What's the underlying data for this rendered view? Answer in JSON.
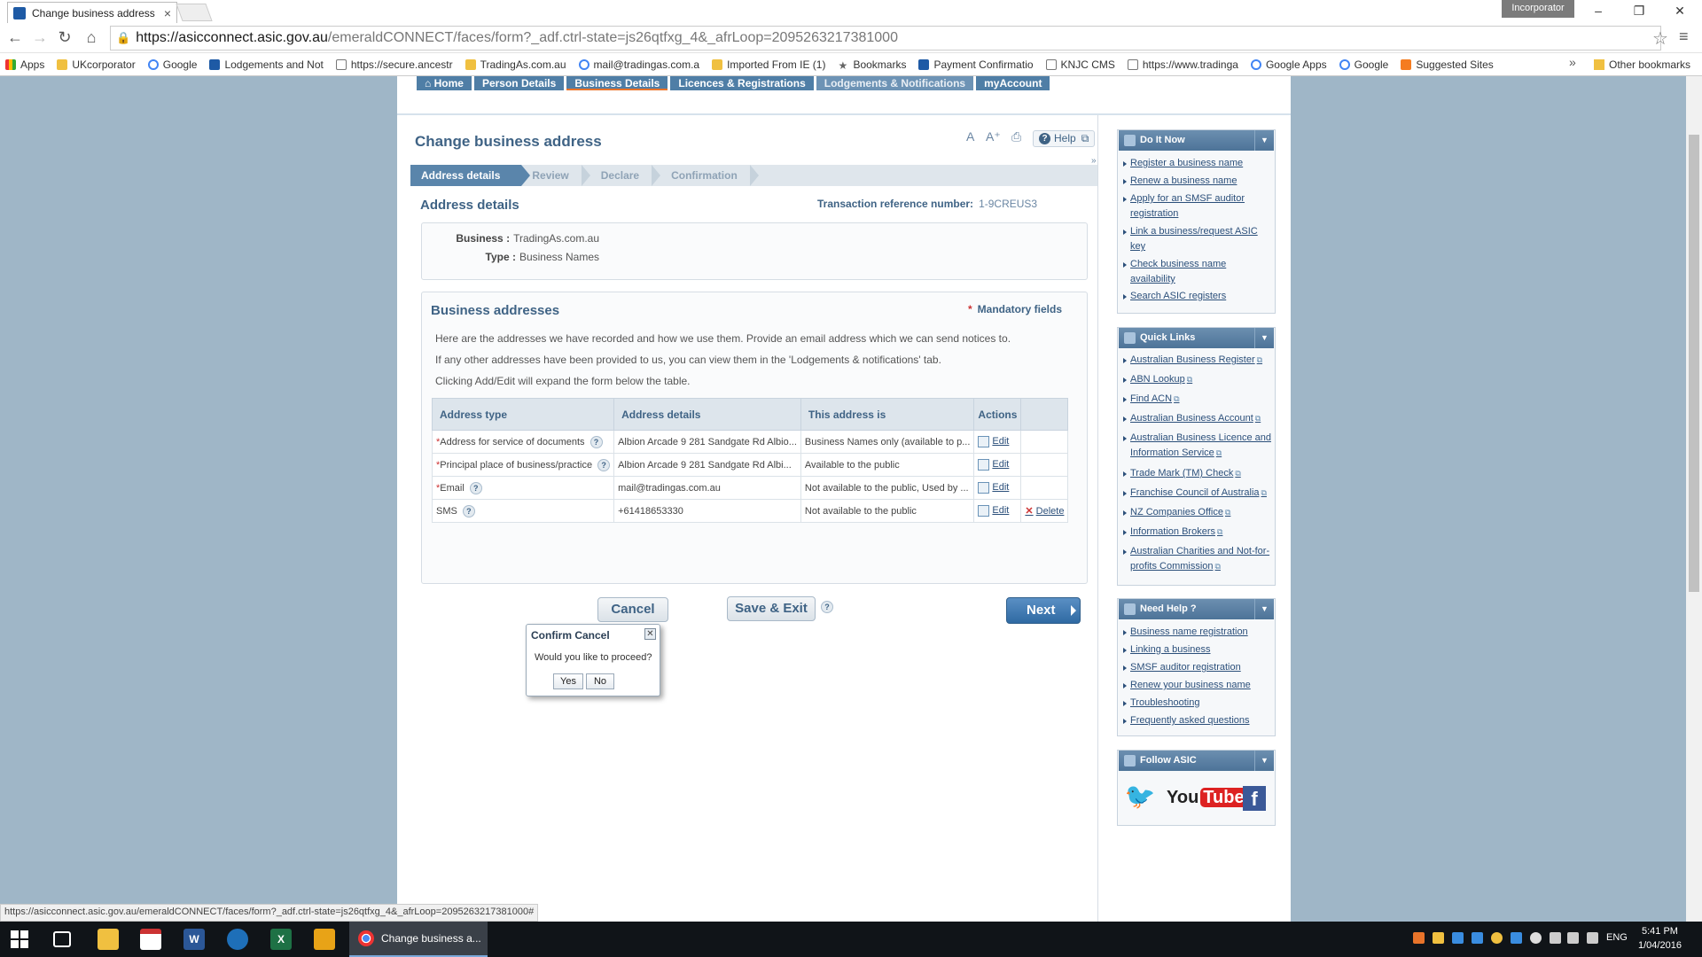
{
  "browser": {
    "tab_title": "Change business address",
    "profile": "Incorporator",
    "url_host": "https://asicconnect.asic.gov.au",
    "url_path": "/emeraldCONNECT/faces/form?_adf.ctrl-state=js26qtfxg_4&_afrLoop=2095263217381000",
    "bookmarks": [
      "Apps",
      "UKcorporator",
      "Google",
      "Lodgements and Not",
      "https://secure.ancestr",
      "TradingAs.com.au",
      "mail@tradingas.com.a",
      "Imported From IE (1)",
      "Bookmarks",
      "Payment Confirmatio",
      "KNJC CMS",
      "https://www.tradinga",
      "Google Apps",
      "Google",
      "Suggested Sites"
    ],
    "other_bookmarks": "Other bookmarks",
    "status_url": "https://asicconnect.asic.gov.au/emeraldCONNECT/faces/form?_adf.ctrl-state=js26qtfxg_4&_afrLoop=2095263217381000#"
  },
  "nav": {
    "tabs": [
      "Home",
      "Person Details",
      "Business Details",
      "Licences & Registrations",
      "Lodgements & Notifications",
      "myAccount"
    ]
  },
  "page": {
    "title": "Change business address",
    "help": "Help",
    "expand": "»",
    "steps": [
      "Address details",
      "Review",
      "Declare",
      "Confirmation"
    ],
    "section_heading": "Address details",
    "tx_ref_label": "Transaction reference number:",
    "tx_ref_value": "1-9CREUS3",
    "business_label": "Business :",
    "business_value": "TradingAs.com.au",
    "type_label": "Type :",
    "type_value": "Business Names"
  },
  "addresses": {
    "title": "Business addresses",
    "mandatory": "Mandatory fields",
    "mandatory_marker": "*",
    "para1": "Here are the addresses we have recorded and how we use them. Provide an email address which we can send notices to.",
    "para2": "If any other addresses have been provided to us, you can view them in the 'Lodgements & notifications' tab.",
    "para3": "Clicking Add/Edit will expand the form below the table.",
    "headers": [
      "Address type",
      "Address details",
      "This address is",
      "Actions",
      ""
    ],
    "help_mark": "?",
    "rows": [
      {
        "required": "*",
        "type": "Address for service of documents",
        "details": "Albion Arcade 9 281 Sandgate Rd Albio...",
        "usage": "Business Names only (available to p...",
        "edit": "Edit",
        "delete": ""
      },
      {
        "required": "*",
        "type": "Principal place of business/practice",
        "details": "Albion Arcade 9 281 Sandgate Rd Albi...",
        "usage": "Available to the public",
        "edit": "Edit",
        "delete": ""
      },
      {
        "required": "*",
        "type": "Email",
        "details": "mail@tradingas.com.au",
        "usage": "Not available to the public, Used by ...",
        "edit": "Edit",
        "delete": ""
      },
      {
        "required": "",
        "type": "SMS",
        "details": "+61418653330",
        "usage": "Not available to the public",
        "edit": "Edit",
        "delete": "Delete"
      }
    ]
  },
  "buttons": {
    "cancel": "Cancel",
    "save_exit": "Save & Exit",
    "save_help": "?",
    "next": "Next"
  },
  "dialog": {
    "title": "Confirm Cancel",
    "message": "Would you like to proceed?",
    "yes": "Yes",
    "no": "No"
  },
  "sidebar": {
    "do_it_now": {
      "title": "Do It Now",
      "links": [
        "Register a business name",
        "Renew a business name",
        "Apply for an SMSF auditor registration",
        "Link a business/request ASIC key",
        "Check business name availability",
        "Search ASIC registers"
      ]
    },
    "quick_links": {
      "title": "Quick Links",
      "links": [
        "Australian Business Register",
        "ABN Lookup",
        "Find ACN",
        "Australian Business Account",
        "Australian Business Licence and Information Service",
        "Trade Mark (TM) Check",
        "Franchise Council of Australia",
        "NZ Companies Office",
        "Information Brokers",
        "Australian Charities and Not-for-profits Commission"
      ]
    },
    "need_help": {
      "title": "Need Help ?",
      "links": [
        "Business name registration",
        "Linking a business",
        "SMSF auditor registration",
        "Renew your business name",
        "Troubleshooting",
        "Frequently asked questions"
      ]
    },
    "follow": {
      "title": "Follow ASIC",
      "youtube": "YouTube"
    }
  },
  "taskbar": {
    "chrome_label": "Change business a...",
    "lang": "ENG",
    "time": "5:41 PM",
    "date": "1/04/2016"
  },
  "colors": {
    "accent": "#3f6385",
    "nav": "#4f7ea6",
    "next": "#2f6aa3",
    "page_bg": "#9fb6c7"
  }
}
